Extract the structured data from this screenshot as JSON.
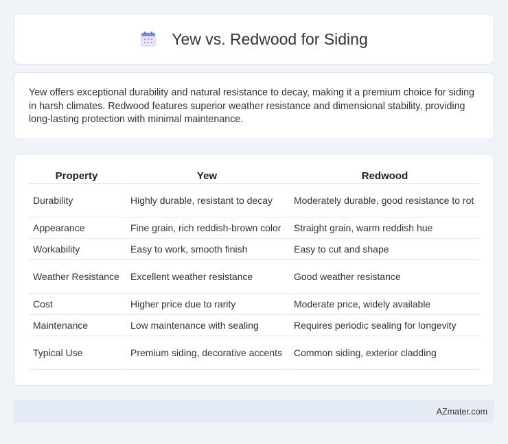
{
  "header": {
    "title": "Yew vs. Redwood for Siding",
    "icon": "calendar-icon"
  },
  "intro": {
    "text": "Yew offers exceptional durability and natural resistance to decay, making it a premium choice for siding in harsh climates. Redwood features superior weather resistance and dimensional stability, providing long-lasting protection with minimal maintenance."
  },
  "table": {
    "headers": [
      "Property",
      "Yew",
      "Redwood"
    ],
    "rows": [
      [
        "Durability",
        "Highly durable, resistant to decay",
        "Moderately durable, good resistance to rot"
      ],
      [
        "Appearance",
        "Fine grain, rich reddish-brown color",
        "Straight grain, warm reddish hue"
      ],
      [
        "Workability",
        "Easy to work, smooth finish",
        "Easy to cut and shape"
      ],
      [
        "Weather Resistance",
        "Excellent weather resistance",
        "Good weather resistance"
      ],
      [
        "Cost",
        "Higher price due to rarity",
        "Moderate price, widely available"
      ],
      [
        "Maintenance",
        "Low maintenance with sealing",
        "Requires periodic sealing for longevity"
      ],
      [
        "Typical Use",
        "Premium siding, decorative accents",
        "Common siding, exterior cladding"
      ]
    ]
  },
  "footer": {
    "brand": "AZmater.com"
  },
  "colors": {
    "background": "#f0f3f8",
    "card": "#ffffff",
    "footer": "#e5ebf5",
    "icon_accent": "#6b7fd7"
  }
}
